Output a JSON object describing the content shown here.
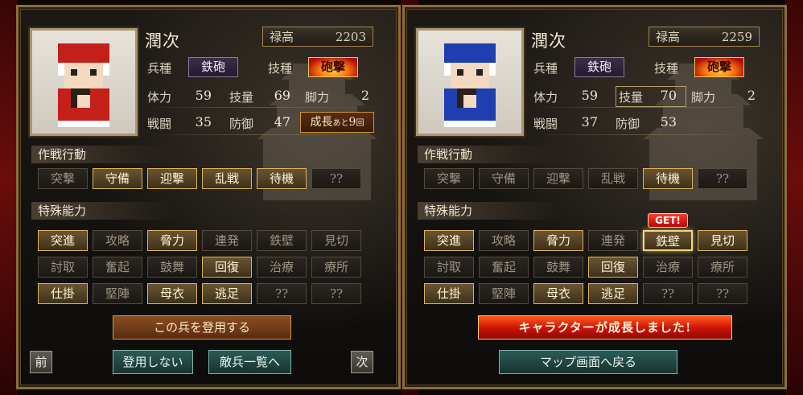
{
  "panels": [
    {
      "name": "潤次",
      "koku_label": "禄高",
      "koku_value": "2203",
      "unit_label": "兵種",
      "unit_value": "鉄砲",
      "skill_label": "技種",
      "skill_value": "砲撃",
      "hp_label": "体力",
      "hp": "59",
      "skill_amt_label": "技量",
      "skill_amt": "69",
      "leg_label": "脚力",
      "leg": "2",
      "atk_label": "戦闘",
      "atk": "35",
      "def_label": "防御",
      "def": "47",
      "growth_prefix": "成長",
      "growth_mid": "あと",
      "growth_num": "9",
      "growth_suffix": "回",
      "tactics_title": "作戦行動",
      "tactics": [
        {
          "label": "突撃",
          "state": "off"
        },
        {
          "label": "守備",
          "state": "on"
        },
        {
          "label": "迎撃",
          "state": "on"
        },
        {
          "label": "乱戦",
          "state": "on"
        },
        {
          "label": "待機",
          "state": "on"
        },
        {
          "label": "??",
          "state": "off"
        }
      ],
      "abilities_title": "特殊能力",
      "abilities": [
        {
          "label": "突進",
          "state": "on"
        },
        {
          "label": "攻略",
          "state": "off"
        },
        {
          "label": "脅力",
          "state": "on"
        },
        {
          "label": "連発",
          "state": "off"
        },
        {
          "label": "鉄壁",
          "state": "off"
        },
        {
          "label": "見切",
          "state": "off"
        },
        {
          "label": "討取",
          "state": "off"
        },
        {
          "label": "奮起",
          "state": "off"
        },
        {
          "label": "鼓舞",
          "state": "off"
        },
        {
          "label": "回復",
          "state": "on"
        },
        {
          "label": "治療",
          "state": "off"
        },
        {
          "label": "療所",
          "state": "off"
        },
        {
          "label": "仕掛",
          "state": "on"
        },
        {
          "label": "堅陣",
          "state": "off"
        },
        {
          "label": "母衣",
          "state": "on"
        },
        {
          "label": "逃足",
          "state": "on"
        },
        {
          "label": "??",
          "state": "off"
        },
        {
          "label": "??",
          "state": "off"
        }
      ],
      "recruit_button": "この兵を登用する",
      "prev_button": "前",
      "next_button": "次",
      "decline_button": "登用しない",
      "enemy_list_button": "敵兵一覧へ",
      "uniform_color": "#c4201a"
    },
    {
      "name": "潤次",
      "koku_label": "禄高",
      "koku_value": "2259",
      "unit_label": "兵種",
      "unit_value": "鉄砲",
      "skill_label": "技種",
      "skill_value": "砲撃",
      "hp_label": "体力",
      "hp": "59",
      "skill_amt_label": "技量",
      "skill_amt": "70",
      "leg_label": "脚力",
      "leg": "2",
      "atk_label": "戦闘",
      "atk": "37",
      "def_label": "防御",
      "def": "53",
      "tactics_title": "作戦行動",
      "tactics": [
        {
          "label": "突撃",
          "state": "off"
        },
        {
          "label": "守備",
          "state": "off"
        },
        {
          "label": "迎撃",
          "state": "off"
        },
        {
          "label": "乱戦",
          "state": "off"
        },
        {
          "label": "待機",
          "state": "on"
        },
        {
          "label": "??",
          "state": "off"
        }
      ],
      "abilities_title": "特殊能力",
      "get_badge": "GET!",
      "abilities": [
        {
          "label": "突進",
          "state": "on"
        },
        {
          "label": "攻略",
          "state": "off"
        },
        {
          "label": "脅力",
          "state": "on"
        },
        {
          "label": "連発",
          "state": "off"
        },
        {
          "label": "鉄壁",
          "state": "new"
        },
        {
          "label": "見切",
          "state": "on"
        },
        {
          "label": "討取",
          "state": "off"
        },
        {
          "label": "奮起",
          "state": "off"
        },
        {
          "label": "鼓舞",
          "state": "off"
        },
        {
          "label": "回復",
          "state": "on"
        },
        {
          "label": "治療",
          "state": "off"
        },
        {
          "label": "療所",
          "state": "off"
        },
        {
          "label": "仕掛",
          "state": "on"
        },
        {
          "label": "堅陣",
          "state": "off"
        },
        {
          "label": "母衣",
          "state": "on"
        },
        {
          "label": "逃足",
          "state": "on"
        },
        {
          "label": "??",
          "state": "off"
        },
        {
          "label": "??",
          "state": "off"
        }
      ],
      "growth_banner": "キャラクターが成長しました!",
      "return_button": "マップ画面へ戻る",
      "uniform_color": "#1f3fb0"
    }
  ]
}
